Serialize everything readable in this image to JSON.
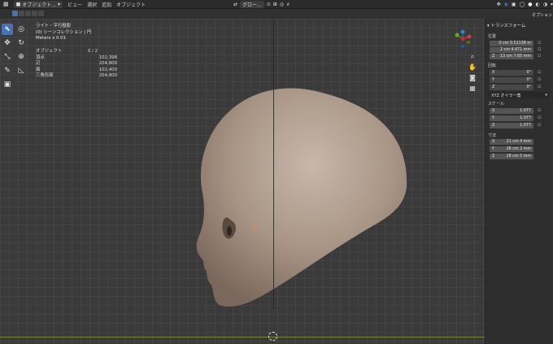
{
  "header": {
    "mode_label": "オブジェクト...",
    "menus": [
      "ビュー",
      "選択",
      "追加",
      "オブジェクト"
    ],
    "transform_orientation": "グロー..."
  },
  "sidebar_tab": {
    "label": "オプション"
  },
  "overlay": {
    "view_name": "ライト・平行投影",
    "collection": "(0) シーンコレクション | 円",
    "units": "Meters x 0.01",
    "stats": [
      {
        "label": "オブジェクト",
        "value": "0 / 2"
      },
      {
        "label": "頂点",
        "value": "102,398"
      },
      {
        "label": "辺",
        "value": "204,800"
      },
      {
        "label": "面",
        "value": "102,400"
      },
      {
        "label": "三角形面",
        "value": "204,800"
      }
    ]
  },
  "transform_panel": {
    "title": "トランスフォーム",
    "location_label": "位置",
    "location": [
      {
        "axis": "",
        "value": "0 cm 0.51138 m"
      },
      {
        "axis": "",
        "value": "2 cm 4.471 mm"
      },
      {
        "axis": "Z",
        "value": "13 cm 7.65 mm"
      }
    ],
    "rotation_label": "回転",
    "rotation": [
      {
        "axis": "X",
        "value": "0°"
      },
      {
        "axis": "Y",
        "value": "0°"
      },
      {
        "axis": "Z",
        "value": "0°"
      }
    ],
    "rotation_mode": "XYZ オイラー角",
    "scale_label": "スケール",
    "scale": [
      {
        "axis": "X",
        "value": "1.077"
      },
      {
        "axis": "Y",
        "value": "1.077"
      },
      {
        "axis": "Z",
        "value": "1.077"
      }
    ],
    "dimensions_label": "寸法",
    "dimensions": [
      {
        "axis": "X",
        "value": "21 cm 4 mm"
      },
      {
        "axis": "Y",
        "value": "26 cm 2 mm"
      },
      {
        "axis": "Z",
        "value": "28 cm 5 mm"
      }
    ]
  },
  "colors": {
    "accent": "#4772b3",
    "viewport_bg": "#3a3a3a",
    "head_base": "#a08e82",
    "gizmo_x": "#e0384b",
    "gizmo_y": "#6fa51f",
    "gizmo_z": "#2f83e3"
  }
}
